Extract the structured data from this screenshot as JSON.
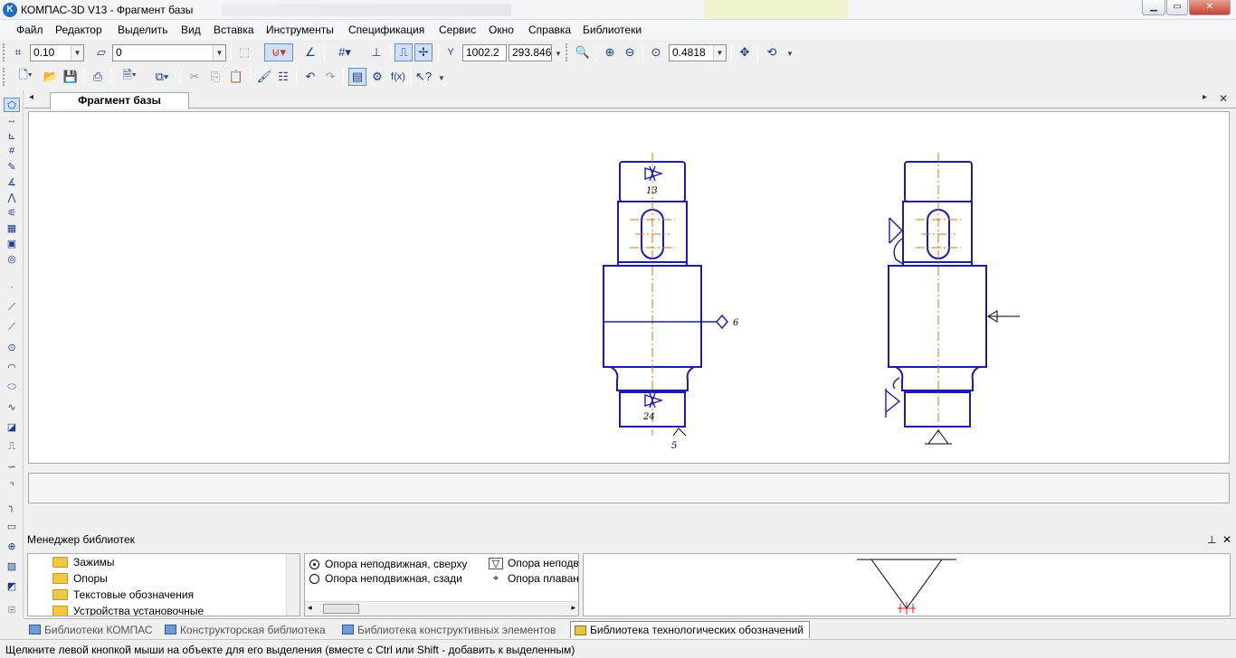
{
  "window": {
    "title": "КОМПАС-3D V13 - Фрагмент базы",
    "app_icon_letter": "K"
  },
  "menu": [
    {
      "label": "Файл"
    },
    {
      "label": "Редактор"
    },
    {
      "label": "Выделить"
    },
    {
      "label": "Вид"
    },
    {
      "label": "Вставка"
    },
    {
      "label": "Инструменты"
    },
    {
      "label": "Спецификация"
    },
    {
      "label": "Сервис"
    },
    {
      "label": "Окно"
    },
    {
      "label": "Справка"
    },
    {
      "label": "Библиотеки"
    }
  ],
  "toolbar": {
    "step_value": "0.10",
    "layer_value": "0",
    "coord_x": "1002.2",
    "coord_y": "293.846",
    "zoom_value": "0.4818",
    "coord_label": "Y",
    "fx_label": "f(x)"
  },
  "document": {
    "tab_label": "Фрагмент базы",
    "drawing_labels": [
      "13",
      "6",
      "24",
      "5"
    ]
  },
  "library_manager": {
    "title": "Менеджер библиотек",
    "tree_items": [
      "Зажимы",
      "Опоры",
      "Текстовые обозначения",
      "Устройства установочные"
    ],
    "items_col1": [
      "Опора неподвижная, сверху",
      "Опора неподвижная, сзади"
    ],
    "items_col2": [
      "Опора неподв",
      "Опора плаван"
    ]
  },
  "library_tabs": [
    {
      "label": "Библиотеки КОМПАС"
    },
    {
      "label": "Конструкторская библиотека"
    },
    {
      "label": "Библиотека конструктивных элементов"
    },
    {
      "label": "Библиотека технологических обозначений"
    }
  ],
  "status": {
    "text": "Щелкните левой кнопкой мыши на объекте для его выделения (вместе с Ctrl или Shift - добавить к выделенным)"
  },
  "colors": {
    "drawing_line": "#1c1ca8",
    "axis_line": "#c8781e",
    "accent": "#1e6cc4"
  }
}
